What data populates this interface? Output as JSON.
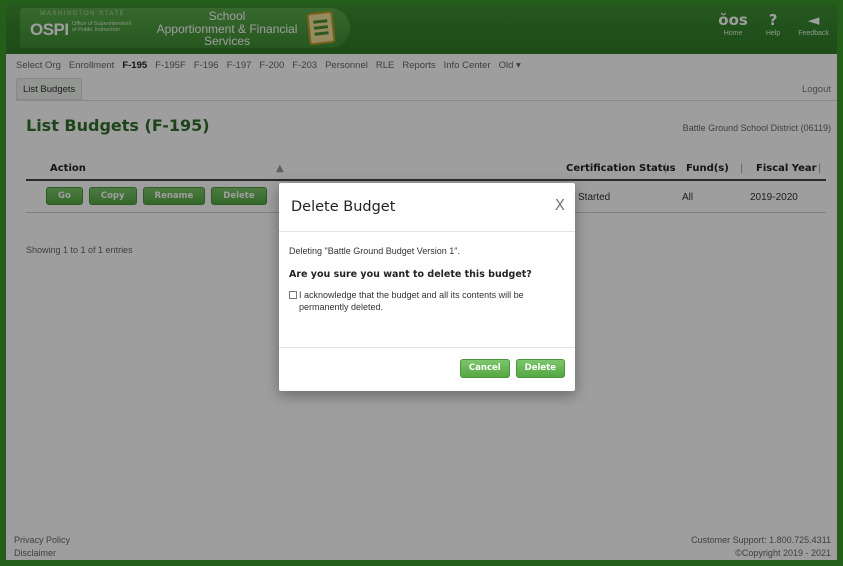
{
  "header": {
    "brand_abbr": "OSPI",
    "brand_state": "WASHINGTON STATE",
    "brand_office": "Office of Superintendent of Public Instruction",
    "brand_title_line1": "School",
    "brand_title_line2": "Apportionment & Financial",
    "brand_title_line3": "Services",
    "icons": [
      {
        "name": "home",
        "glyph": "ŏos",
        "label": "Home"
      },
      {
        "name": "help",
        "glyph": "?",
        "label": "Help"
      },
      {
        "name": "feedback",
        "glyph": "◄",
        "label": "Feedback"
      }
    ]
  },
  "nav": {
    "links": [
      "Select Org",
      "Enrollment",
      "F-195",
      "F-195F",
      "F-196",
      "F-197",
      "F-200",
      "F-203",
      "Personnel",
      "RLE",
      "Reports",
      "Info Center",
      "Old ▾"
    ],
    "active": "F-195",
    "sub_tab": "List Budgets",
    "logout": "Logout"
  },
  "page": {
    "title": "List Budgets (F-195)",
    "district": "Battle Ground School District (06119)"
  },
  "table": {
    "headers": {
      "action": "Action",
      "certification_status": "Certification Status",
      "funds": "Fund(s)",
      "fiscal_year": "Fiscal Year"
    },
    "row": {
      "buttons": [
        "Go",
        "Copy",
        "Rename",
        "Delete"
      ],
      "status": "Started",
      "funds": "All",
      "fiscal_year": "2019-2020"
    },
    "showing": "Showing 1 to 1 of 1 entries"
  },
  "footer": {
    "privacy": "Privacy Policy",
    "disclaimer": "Disclaimer",
    "support": "Customer Support: 1.800.725.4311",
    "copyright": "©Copyright 2019 - 2021"
  },
  "modal": {
    "title": "Delete Budget",
    "close": "X",
    "deleting_text": "Deleting \"Battle Ground Budget Version 1\".",
    "question": "Are you sure you want to delete this budget?",
    "acknowledge": "I acknowledge that the budget and all its contents will be permanently deleted.",
    "cancel_label": "Cancel",
    "delete_label": "Delete"
  },
  "colors": {
    "brand_green": "#3d8e32",
    "button_green": "#6ab85a",
    "title_green": "#2f6f2a"
  }
}
